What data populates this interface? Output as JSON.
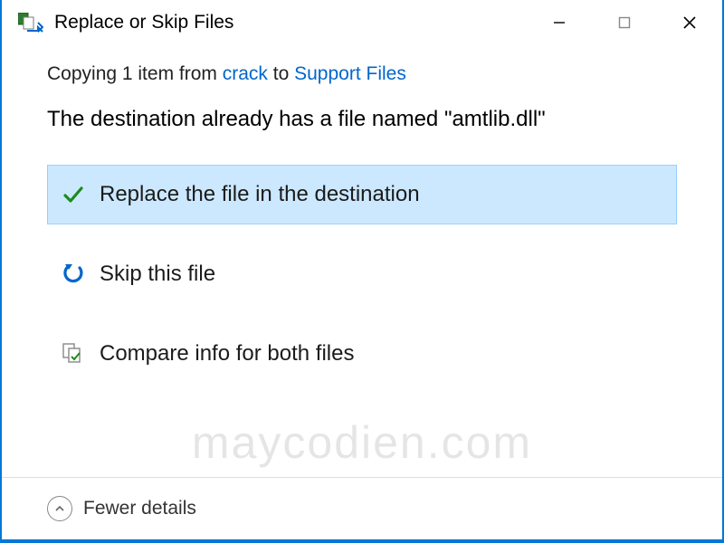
{
  "titlebar": {
    "title": "Replace or Skip Files"
  },
  "copy": {
    "prefix": "Copying 1 item from ",
    "source": "crack",
    "mid": " to ",
    "dest": "Support Files"
  },
  "conflict": "The destination already has a file named \"amtlib.dll\"",
  "options": {
    "replace": "Replace the file in the destination",
    "skip": "Skip this file",
    "compare": "Compare info for both files"
  },
  "footer": {
    "toggle": "Fewer details"
  },
  "watermark": "maycodien.com"
}
